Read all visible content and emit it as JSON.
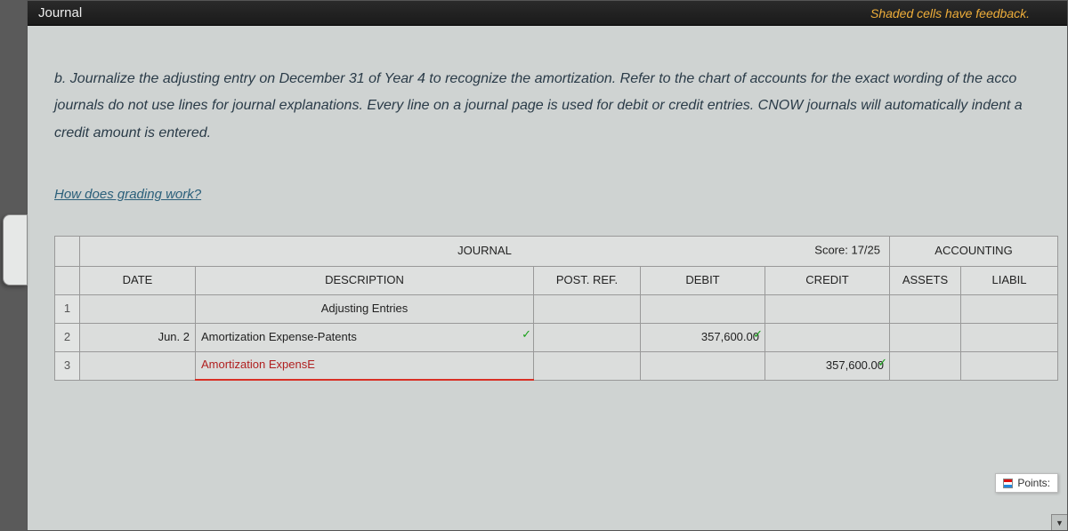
{
  "header": {
    "title": "Journal",
    "hint": "Shaded cells have feedback."
  },
  "instructions": "b. Journalize the adjusting entry on December 31 of Year 4 to recognize the amortization. Refer to the chart of accounts for the exact wording of the acco journals do not use lines for journal explanations. Every line on a journal page is used for debit or credit entries. CNOW journals will automatically indent a credit amount is entered.",
  "grading_link": "How does grading work?",
  "journal": {
    "title": "JOURNAL",
    "score_label": "Score: 17/25",
    "equation_label": "ACCOUNTING",
    "columns": {
      "date": "DATE",
      "description": "DESCRIPTION",
      "postref": "POST. REF.",
      "debit": "DEBIT",
      "credit": "CREDIT",
      "assets": "ASSETS",
      "liabil": "LIABIL"
    },
    "rows": [
      {
        "num": "1",
        "date": "",
        "description": "Adjusting Entries",
        "postref": "",
        "debit": "",
        "credit": "",
        "is_header": true
      },
      {
        "num": "2",
        "date": "Jun. 2",
        "description": "Amortization Expense-Patents",
        "postref": "",
        "debit": "357,600.00",
        "credit": "",
        "desc_ok": true,
        "debit_ok": true
      },
      {
        "num": "3",
        "date": "",
        "description": "Amortization ExpensE",
        "postref": "",
        "debit": "",
        "credit": "357,600.00",
        "desc_wrong": true,
        "credit_ok": true,
        "indent": true
      }
    ]
  },
  "points_label": "Points:"
}
